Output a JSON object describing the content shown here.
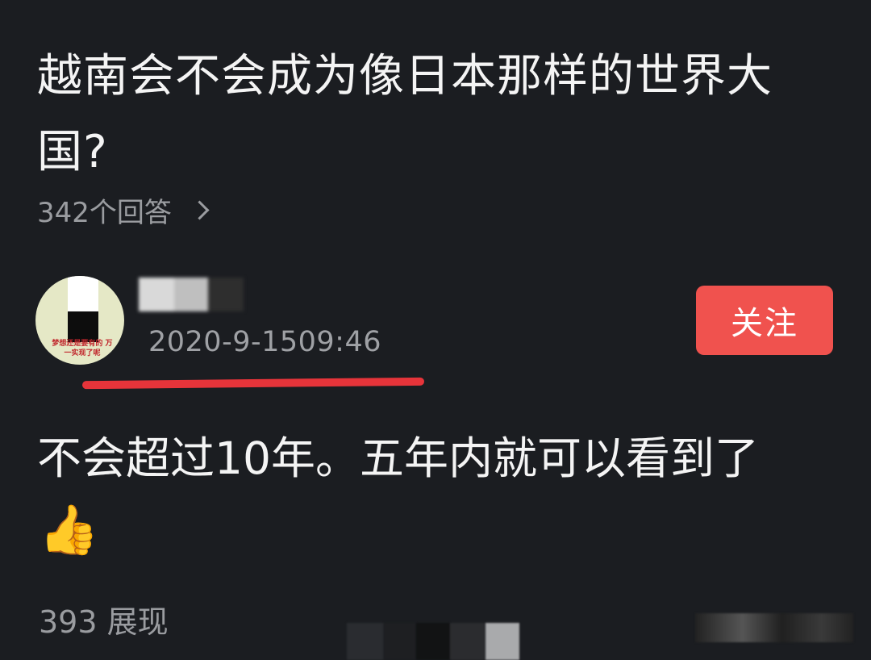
{
  "question": {
    "title": "越南会不会成为像日本那样的世界大国?",
    "answer_count": "342个回答"
  },
  "answer": {
    "author_name": "██ █ ]",
    "avatar_caption": "梦想还是要有的 万一实现了呢",
    "timestamp": "2020-9-1509:46",
    "follow_label": "关注",
    "text": "不会超过10年。五年内就可以看到了",
    "emoji": "👍",
    "view_count": "393 展现"
  },
  "colors": {
    "background": "#1b1d21",
    "follow_button": "#f0524e",
    "underline": "#e6343a",
    "secondary_text": "#9a9ca0"
  }
}
